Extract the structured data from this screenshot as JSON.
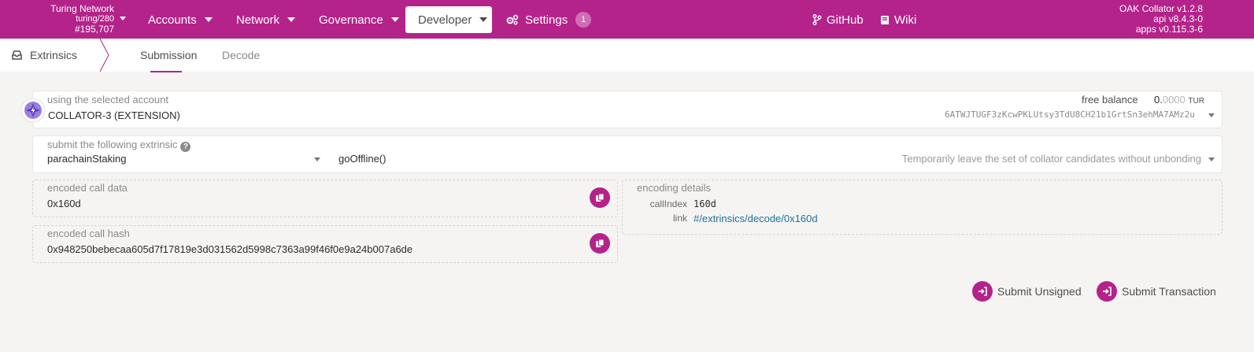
{
  "topbar": {
    "chain_name": "Turing Network",
    "chain_spec": "turing/280",
    "block_number": "#195,707",
    "nav": {
      "accounts": "Accounts",
      "network": "Network",
      "governance": "Governance",
      "developer": "Developer",
      "settings": "Settings",
      "settings_badge": "1"
    },
    "links": {
      "github": "GitHub",
      "wiki": "Wiki"
    },
    "node": "OAK Collator v1.2.8",
    "api": "api v8.4.3-0",
    "apps": "apps v0.115.3-6"
  },
  "tabs": {
    "root": "Extrinsics",
    "submission": "Submission",
    "decode": "Decode"
  },
  "account": {
    "label": "using the selected account",
    "name": "COLLATOR-3 (EXTENSION)",
    "balance_label": "free balance",
    "balance_int": "0.",
    "balance_dec": "0000",
    "balance_unit": "TUR",
    "address": "6ATWJTUGF3zKcwPKLUtsy3TdU8CH21b1GrtSn3ehMA7AMz2u"
  },
  "extrinsic": {
    "label": "submit the following extrinsic",
    "help": "?",
    "pallet": "parachainStaking",
    "method": "goOffline()",
    "description": "Temporarily leave the set of collator candidates without unbonding"
  },
  "encoded_call": {
    "label": "encoded call data",
    "value": "0x160d"
  },
  "encoded_hash": {
    "label": "encoded call hash",
    "value": "0x948250bebecaa605d7f17819e3d031562d5998c7363a99f46f0e9a24b007a6de"
  },
  "encoding_details": {
    "label": "encoding details",
    "call_index_label": "callIndex",
    "call_index_value": "160d",
    "link_label": "link",
    "link_value": "#/extrinsics/decode/0x160d"
  },
  "actions": {
    "submit_unsigned": "Submit Unsigned",
    "submit_transaction": "Submit Transaction"
  },
  "colors": {
    "brand": "#b4238a",
    "link": "#1a75a3",
    "background": "#f5f4f3"
  }
}
